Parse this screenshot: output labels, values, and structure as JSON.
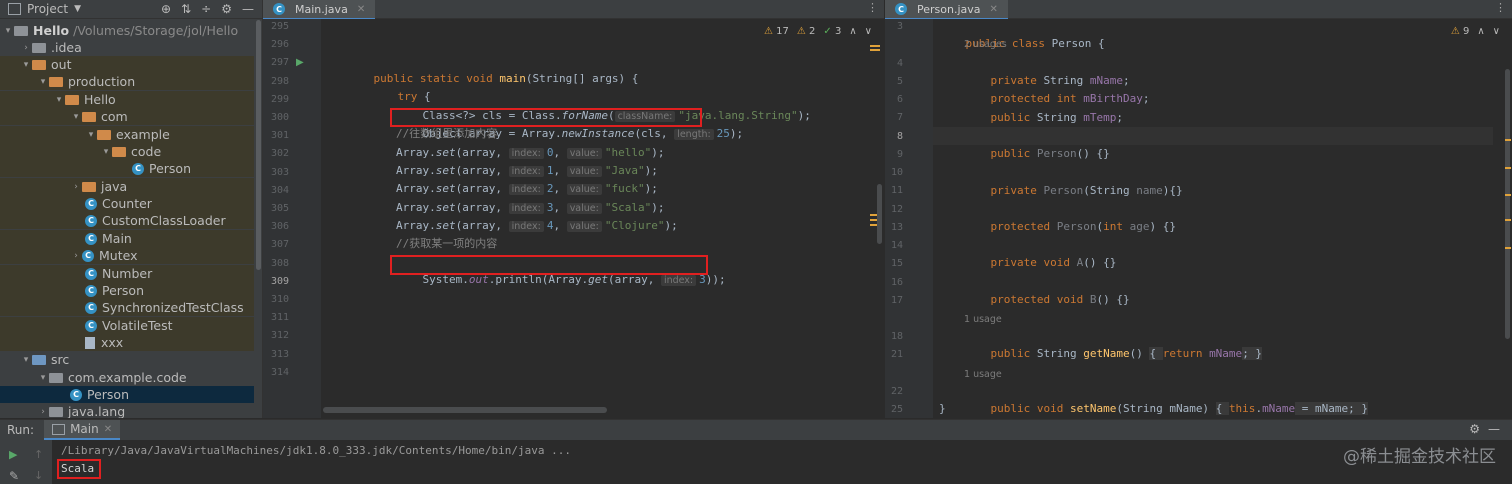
{
  "project_panel": {
    "title": "Project",
    "tree": [
      {
        "label": "Hello",
        "path": "/Volumes/Storage/jol/Hello"
      },
      {
        "label": ".idea"
      },
      {
        "label": "out"
      },
      {
        "label": "production"
      },
      {
        "label": "Hello"
      },
      {
        "label": "com"
      },
      {
        "label": "example"
      },
      {
        "label": "code"
      },
      {
        "label": "Person"
      },
      {
        "label": "java"
      },
      {
        "label": "Counter"
      },
      {
        "label": "CustomClassLoader"
      },
      {
        "label": "Main"
      },
      {
        "label": "Mutex"
      },
      {
        "label": "Number"
      },
      {
        "label": "Person"
      },
      {
        "label": "SynchronizedTestClass"
      },
      {
        "label": "VolatileTest"
      },
      {
        "label": "xxx"
      },
      {
        "label": "src"
      },
      {
        "label": "com.example.code"
      },
      {
        "label": "Person"
      },
      {
        "label": "java.lang"
      }
    ]
  },
  "left_editor": {
    "tab": "Main.java",
    "inspections": {
      "warnings": "17",
      "weak": "2",
      "typos": "3"
    },
    "line_numbers": [
      "295",
      "296",
      "297",
      "298",
      "299",
      "300",
      "301",
      "302",
      "303",
      "304",
      "305",
      "306",
      "307",
      "308",
      "309",
      "310",
      "311",
      "312",
      "313",
      "314"
    ],
    "code": {
      "l1": {
        "kw": "public static void ",
        "name": "main",
        "rest": "(String[] args) {"
      },
      "l2": {
        "kw": "try",
        "rest": " {"
      },
      "l3": {
        "a": "Class<?> cls = Class.",
        "m": "forName",
        "b": "(",
        "hint": "className:",
        "s": "\"java.lang.String\"",
        "c": ");"
      },
      "l4": {
        "a": "Object array = Array.",
        "m": "newInstance",
        "b": "(cls, ",
        "hint": "length:",
        "n": "25",
        "c": ");"
      },
      "l5": "//往数组里添加内容",
      "sets": [
        {
          "hint1": "index:",
          "i": "0",
          "hint2": "value:",
          "v": "\"hello\""
        },
        {
          "hint1": "index:",
          "i": "1",
          "hint2": "value:",
          "v": "\"Java\""
        },
        {
          "hint1": "index:",
          "i": "2",
          "hint2": "value:",
          "v": "\"fuck\""
        },
        {
          "hint1": "index:",
          "i": "3",
          "hint2": "value:",
          "v": "\"Scala\""
        },
        {
          "hint1": "index:",
          "i": "4",
          "hint2": "value:",
          "v": "\"Clojure\""
        }
      ],
      "set_prefix": "Array.",
      "set_method": "set",
      "set_args": "(array, ",
      "set_end": ");",
      "l11": "//获取某一项的内容",
      "l12": {
        "a": "System.",
        "f": "out",
        "b": ".println(Array.",
        "m": "get",
        "c": "(array, ",
        "hint": "index:",
        "n": "3",
        "d": "));"
      }
    }
  },
  "right_editor": {
    "tab": "Person.java",
    "inspections": {
      "warnings": "9"
    },
    "line_numbers": [
      "3",
      "4",
      "5",
      "6",
      "7",
      "8",
      "9",
      "10",
      "11",
      "12",
      "13",
      "14",
      "15",
      "16",
      "17",
      "18",
      "21",
      "22",
      "25"
    ],
    "usages": [
      "2 usages",
      "1 usage",
      "1 usage"
    ],
    "code": {
      "class_decl": {
        "kw": "public class ",
        "name": "Person",
        "rest": " {"
      },
      "f1": {
        "kw": "private ",
        "type": "String ",
        "name": "mName",
        "end": ";"
      },
      "f2": {
        "kw": "protected int ",
        "name": "mBirthDay",
        "end": ";"
      },
      "f3": {
        "kw": "public ",
        "type": "String ",
        "name": "mTemp",
        "end": ";"
      },
      "c1": {
        "kw": "public ",
        "name": "Person",
        "rest": "() {}"
      },
      "c2": {
        "kw": "private ",
        "name": "Person",
        "rest1": "(String ",
        "param": "name",
        "rest2": "){}"
      },
      "c3": {
        "kw": "protected ",
        "name": "Person",
        "rest1": "(",
        "kw2": "int ",
        "param": "age",
        "rest2": ") {}"
      },
      "m1": {
        "kw": "private void ",
        "name": "A",
        "rest": "() {}"
      },
      "m2": {
        "kw": "protected void ",
        "name": "B",
        "rest": "() {}"
      },
      "m3": {
        "kw": "public ",
        "type": "String ",
        "name": "getName",
        "rest": "() ",
        "b1": "{ ",
        "kw2": "return ",
        "fld": "mName",
        "b2": "; }"
      },
      "m4": {
        "kw": "public void ",
        "name": "setName",
        "rest": "(String mName) ",
        "b1": "{ ",
        "kw2": "this",
        "dot": ".",
        "fld": "mName",
        "b2": " = mName; }"
      },
      "close": "}"
    }
  },
  "run_panel": {
    "label": "Run:",
    "tab": "Main",
    "command": "/Library/Java/JavaVirtualMachines/jdk1.8.0_333.jdk/Contents/Home/bin/java ...",
    "output": "Scala"
  },
  "watermark": "@稀土掘金技术社区"
}
